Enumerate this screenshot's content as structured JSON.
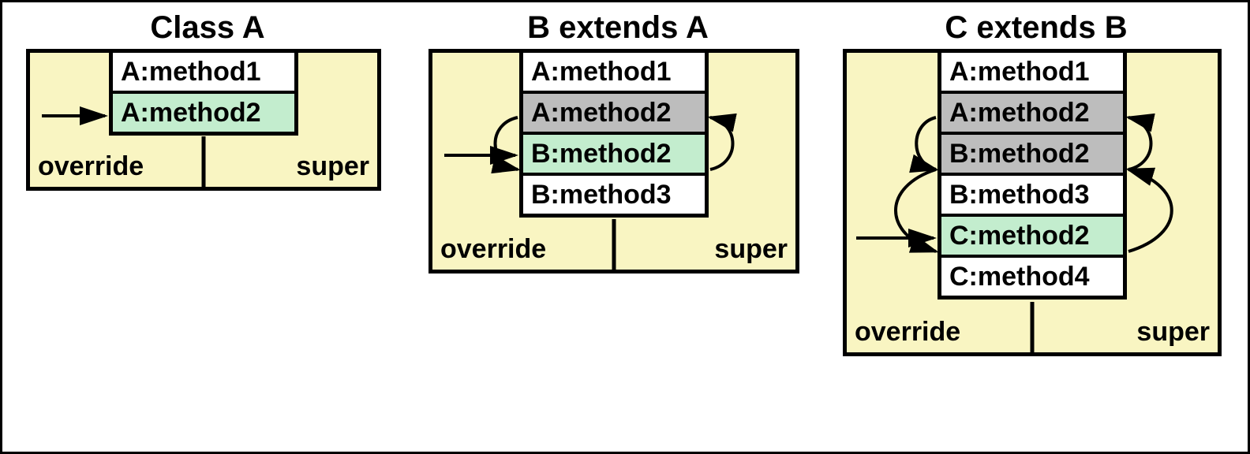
{
  "panels": [
    {
      "title": "Class A",
      "override_label": "override",
      "super_label": "super",
      "methods": [
        {
          "text": "A:method1",
          "bg": "white"
        },
        {
          "text": "A:method2",
          "bg": "green"
        }
      ]
    },
    {
      "title": "B extends A",
      "override_label": "override",
      "super_label": "super",
      "methods": [
        {
          "text": "A:method1",
          "bg": "white"
        },
        {
          "text": "A:method2",
          "bg": "gray"
        },
        {
          "text": "B:method2",
          "bg": "green"
        },
        {
          "text": "B:method3",
          "bg": "white"
        }
      ]
    },
    {
      "title": "C extends B",
      "override_label": "override",
      "super_label": "super",
      "methods": [
        {
          "text": "A:method1",
          "bg": "white"
        },
        {
          "text": "A:method2",
          "bg": "gray"
        },
        {
          "text": "B:method2",
          "bg": "gray"
        },
        {
          "text": "B:method3",
          "bg": "white"
        },
        {
          "text": "C:method2",
          "bg": "green"
        },
        {
          "text": "C:method4",
          "bg": "white"
        }
      ]
    }
  ]
}
